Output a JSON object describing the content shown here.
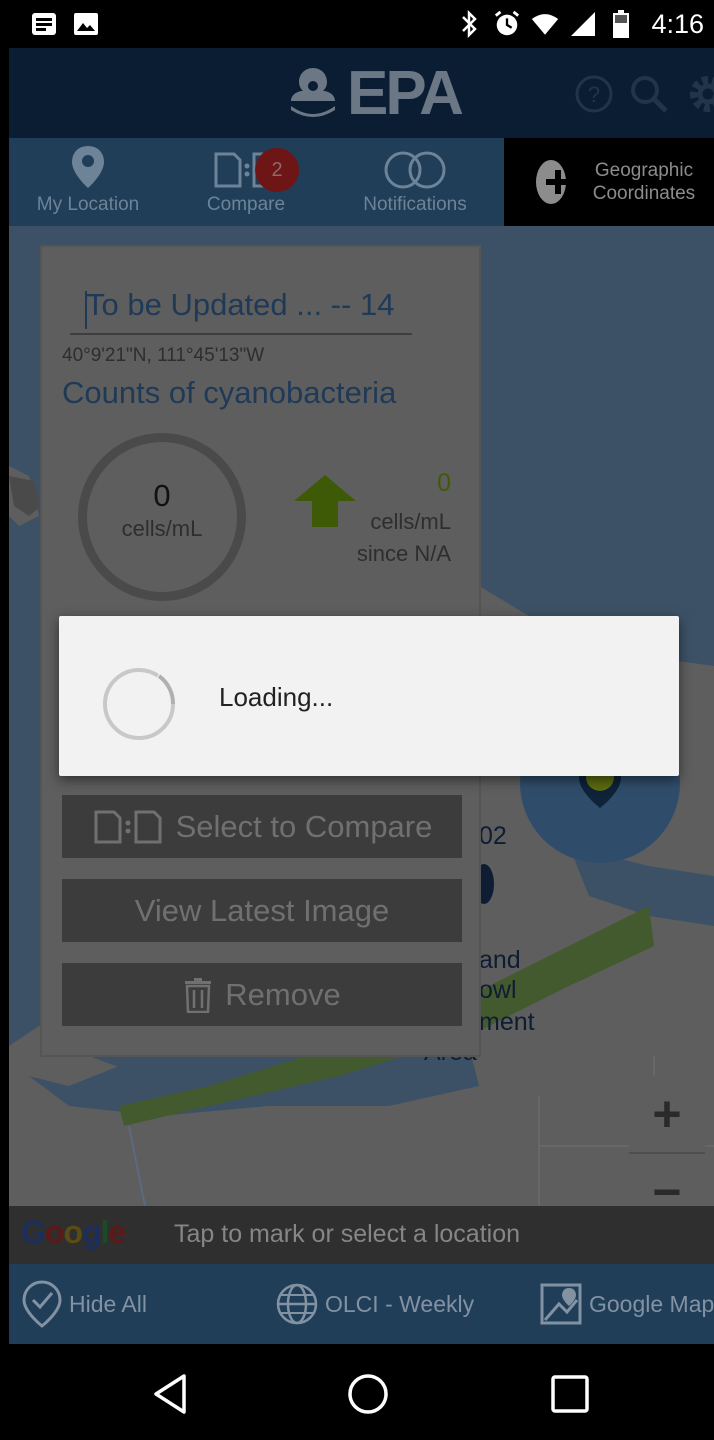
{
  "status_bar": {
    "time": "4:16",
    "left_icons": [
      "news-icon",
      "image-icon"
    ],
    "right_icons": [
      "bluetooth-icon",
      "alarm-icon",
      "wifi-icon",
      "signal-icon",
      "battery-icon"
    ]
  },
  "header": {
    "logo_text": "EPA",
    "tools": [
      "help-icon",
      "search-icon",
      "gear-icon"
    ]
  },
  "nav": {
    "my_location": "My Location",
    "compare": "Compare",
    "compare_badge": "2",
    "notifications": "Notifications",
    "geo_coordinates": "Geographic Coordinates"
  },
  "card": {
    "title": "To be Updated ... -- 14",
    "coords": "40°9'21\"N, 111°45'13\"W",
    "counts_title": "Counts of cyanobacteria",
    "gauge_value": "0",
    "gauge_unit": "cells/mL",
    "trend_value": "0",
    "trend_unit": "cells/mL",
    "trend_since": "since N/A",
    "buttons": {
      "select_compare": "Select to Compare",
      "view_latest": "View Latest Image",
      "remove": "Remove"
    }
  },
  "map": {
    "labels": [
      "02",
      "and",
      "owl",
      "ment",
      "Area"
    ],
    "tap_hint": "Tap to mark or select a location",
    "google": "Google"
  },
  "bottom_bar": {
    "hide_all": "Hide All",
    "layer": "OLCI - Weekly",
    "basemap": "Google Map"
  },
  "dialog": {
    "loading": "Loading..."
  },
  "colors": {
    "header_bg": "#0b1d33",
    "nav_bg": "#203e58",
    "trend_green": "#3f5a07",
    "badge_red": "#6e1515"
  }
}
